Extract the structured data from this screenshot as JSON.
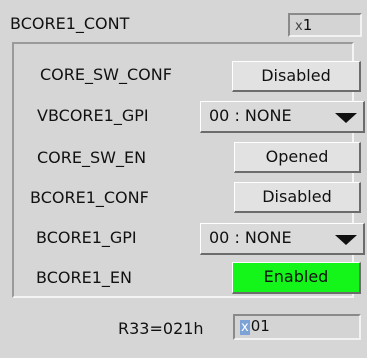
{
  "header": {
    "title": "BCORE1_CONT",
    "num_prefix": "x",
    "num_value": "1"
  },
  "rows": [
    {
      "label": "CORE_SW_CONF",
      "control": "Disabled"
    },
    {
      "label": "VBCORE1_GPI",
      "control": "00 : NONE"
    },
    {
      "label": "CORE_SW_EN",
      "control": "Opened"
    },
    {
      "label": "BCORE1_CONF",
      "control": "Disabled"
    },
    {
      "label": "BCORE1_GPI",
      "control": "00 : NONE"
    },
    {
      "label": "BCORE1_EN",
      "control": "Enabled"
    }
  ],
  "footer": {
    "register": "R33=021h",
    "hex_prefix": "x",
    "hex_value": "01"
  },
  "colors": {
    "enabled_green": "#14f51a",
    "background": "#d6d6d6"
  },
  "icons": {
    "dropdown": "triangle-down-icon"
  }
}
